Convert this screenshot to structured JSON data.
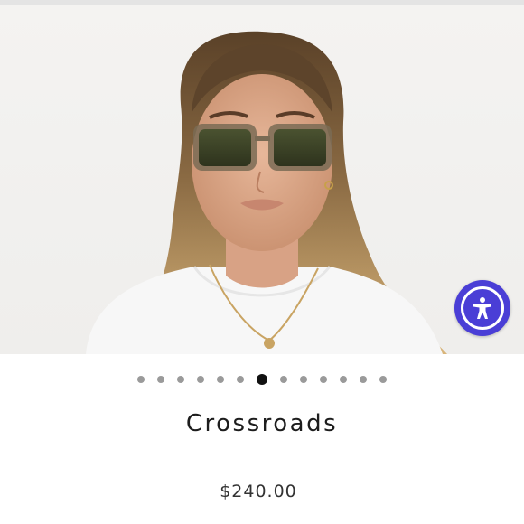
{
  "product": {
    "name": "Crossroads",
    "price": "$240.00"
  },
  "gallery": {
    "image_count": 13,
    "active_index": 6
  },
  "accessibility": {
    "icon": "accessibility-icon",
    "accent": "#4a3ed6"
  },
  "colors": {
    "dot_inactive": "#9a9a9a",
    "dot_active": "#111111",
    "text": "#1d1d1d"
  }
}
